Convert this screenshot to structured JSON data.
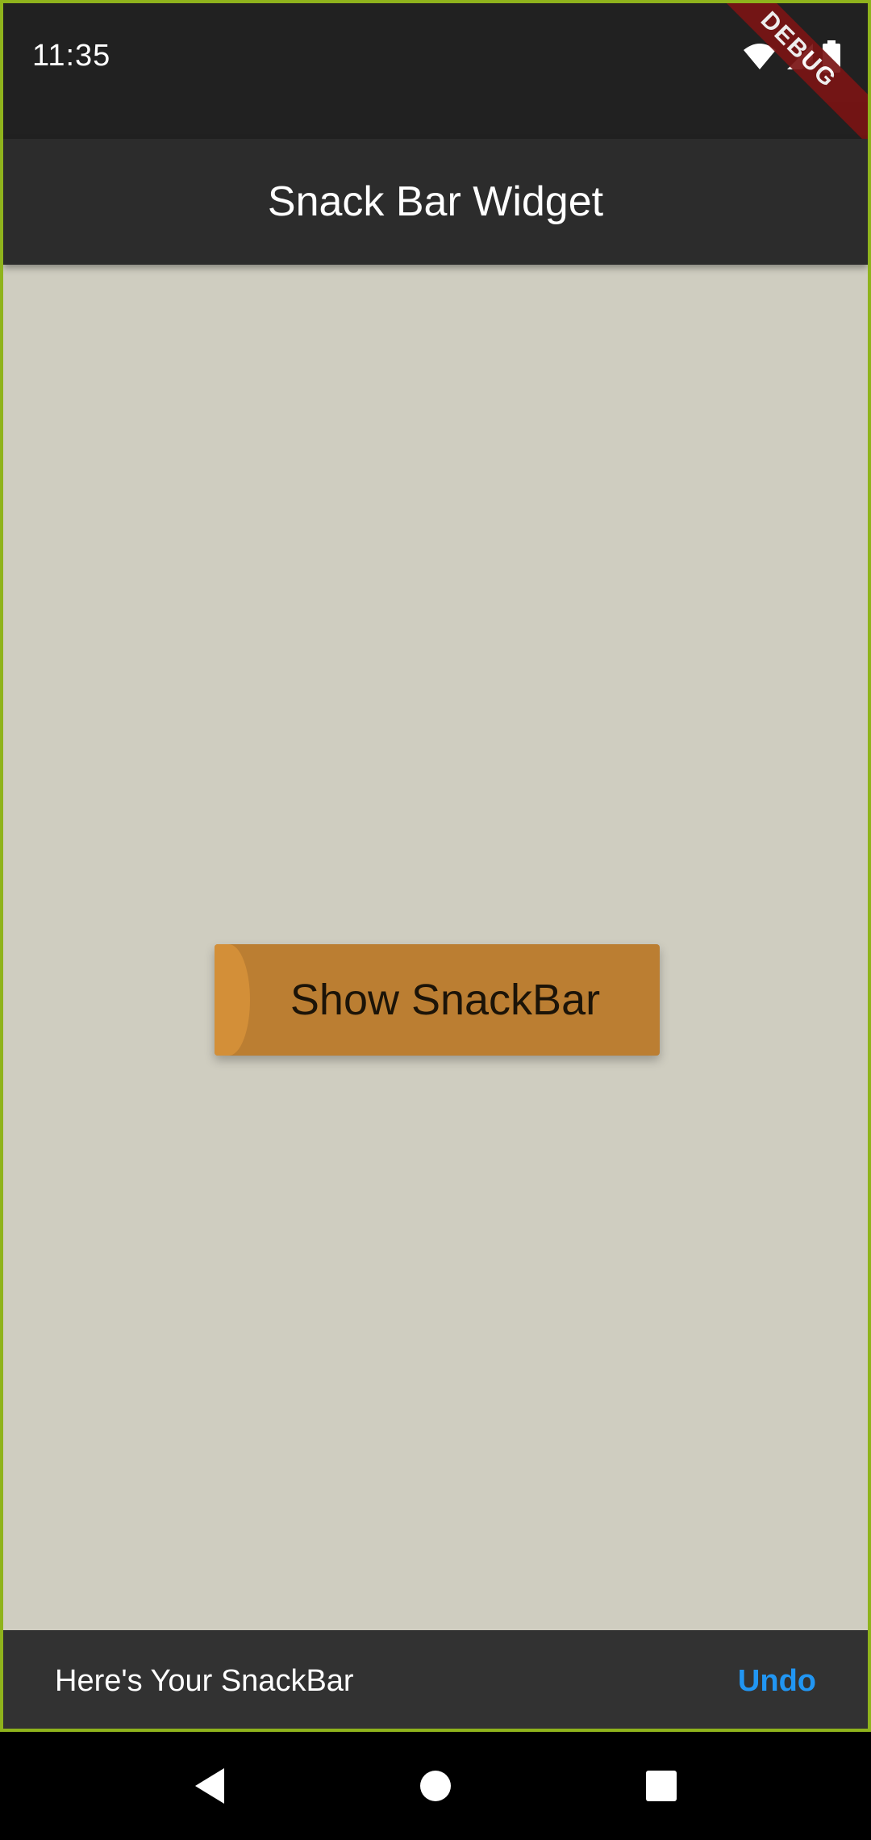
{
  "status_bar": {
    "time": "11:35",
    "icons": [
      "wifi-icon",
      "signal-icon",
      "battery-icon"
    ],
    "debug_banner": "DEBUG"
  },
  "app_bar": {
    "title": "Snack Bar Widget"
  },
  "main": {
    "button_label": "Show SnackBar"
  },
  "snackbar": {
    "message": "Here's Your SnackBar",
    "action_label": "Undo"
  },
  "nav_bar": {
    "buttons": [
      "back-icon",
      "home-icon",
      "recents-icon"
    ]
  },
  "colors": {
    "status_bar": "#212121",
    "app_bar": "#2c2c2c",
    "background": "#cfcdc0",
    "button": "#bb7e32",
    "snackbar": "#323232",
    "snackbar_action": "#2196f3",
    "debug_ribbon": "#7a1414",
    "frame_border": "#8fb31c"
  }
}
